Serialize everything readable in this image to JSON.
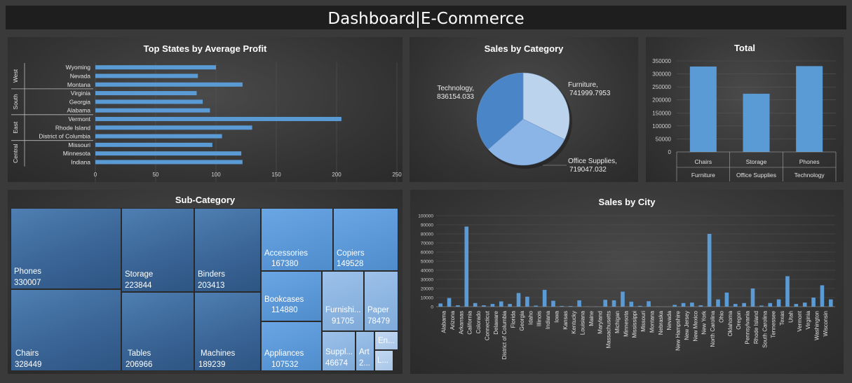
{
  "dashboard": {
    "title": "Dashboard|E-Commerce"
  },
  "panels": {
    "states": {
      "title": "Top States by Average Profit"
    },
    "category": {
      "title": "Sales by Category"
    },
    "total": {
      "title": "Total"
    },
    "subcategory": {
      "title": "Sub-Category"
    },
    "city": {
      "title": "Sales by City"
    }
  },
  "chart_data": [
    {
      "type": "bar",
      "orientation": "horizontal",
      "title": "Top States by Average Profit",
      "groups": [
        {
          "name": "West",
          "categories": [
            "Wyoming",
            "Nevada",
            "Montana"
          ],
          "values": [
            100,
            85,
            122
          ]
        },
        {
          "name": "South",
          "categories": [
            "Virginia",
            "Georgia",
            "Alabama"
          ],
          "values": [
            84,
            89,
            95
          ]
        },
        {
          "name": "East",
          "categories": [
            "Vermont",
            "Rhode Island",
            "District of Columbia"
          ],
          "values": [
            204,
            130,
            105
          ]
        },
        {
          "name": "Central",
          "categories": [
            "Missouri",
            "Minnesota",
            "Indiana"
          ],
          "values": [
            97,
            121,
            122
          ]
        }
      ],
      "xticks": [
        "0",
        "50",
        "100",
        "150",
        "200",
        "250"
      ],
      "xlim": [
        0,
        250
      ],
      "color": "#5b9bd5"
    },
    {
      "type": "pie",
      "title": "Sales by Category",
      "slices": [
        {
          "label": "Furniture",
          "value": 741999.7953,
          "text": "Furniture,",
          "valtext": "741999.7953",
          "color": "#bcd3ee"
        },
        {
          "label": "Office Supplies",
          "value": 719047.032,
          "text": "Office Supplies,",
          "valtext": "719047.032",
          "color": "#8bb5e6"
        },
        {
          "label": "Technology",
          "value": 836154.033,
          "text": "Technology,",
          "valtext": "836154.033",
          "color": "#4a85c8"
        }
      ]
    },
    {
      "type": "bar",
      "title": "Total",
      "categories": [
        {
          "item": "Chairs",
          "group": "Furniture",
          "value": 328449
        },
        {
          "item": "Storage",
          "group": "Office Supplies",
          "value": 223844
        },
        {
          "item": "Phones",
          "group": "Technology",
          "value": 330007
        }
      ],
      "yticks": [
        "0",
        "50000",
        "100000",
        "150000",
        "200000",
        "250000",
        "300000",
        "350000"
      ],
      "ylim": [
        0,
        350000
      ],
      "color": "#5b9bd5"
    },
    {
      "type": "treemap",
      "title": "Sub-Category",
      "cells": [
        {
          "name": "Phones",
          "value": "330007"
        },
        {
          "name": "Chairs",
          "value": "328449"
        },
        {
          "name": "Storage",
          "value": "223844"
        },
        {
          "name": "Tables",
          "value": "206966"
        },
        {
          "name": "Binders",
          "value": "203413"
        },
        {
          "name": "Machines",
          "value": "189239"
        },
        {
          "name": "Accessories",
          "value": "167380"
        },
        {
          "name": "Copiers",
          "value": "149528"
        },
        {
          "name": "Bookcases",
          "value": "114880"
        },
        {
          "name": "Appliances",
          "value": "107532"
        },
        {
          "name": "Furnishi...",
          "value": "91705"
        },
        {
          "name": "Paper",
          "value": "78479"
        },
        {
          "name": "Suppl...",
          "value": "46674"
        },
        {
          "name": "Art",
          "value": "2..."
        },
        {
          "name": "En...",
          "value": ""
        },
        {
          "name": "L...",
          "value": ""
        }
      ]
    },
    {
      "type": "bar",
      "title": "Sales by City",
      "categories": [
        "Alabama",
        "Arizona",
        "Arkansas",
        "California",
        "Colorado",
        "Connecticut",
        "Delaware",
        "District of Columbia",
        "Florida",
        "Georgia",
        "Idaho",
        "Illinois",
        "Indiana",
        "Iowa",
        "Kansas",
        "Kentucky",
        "Louisiana",
        "Maine",
        "Maryland",
        "Massachusetts",
        "Michigan",
        "Minnesota",
        "Mississippi",
        "Missouri",
        "Montana",
        "Nebraska",
        "Nevada",
        "New Hampshire",
        "New Jersey",
        "New Mexico",
        "New York",
        "North Carolina",
        "Ohio",
        "Oklahoma",
        "Oregon",
        "Pennsylvania",
        "Rhode Island",
        "South Carolina",
        "Tennessee",
        "Texas",
        "Utah",
        "Vermont",
        "Virginia",
        "Washington",
        "Wisconsin"
      ],
      "values": [
        3500,
        9500,
        1500,
        88000,
        4000,
        1500,
        3000,
        5800,
        3000,
        15000,
        11000,
        1200,
        18500,
        6500,
        800,
        700,
        7000,
        200,
        200,
        7500,
        7000,
        16500,
        5500,
        900,
        6000,
        200,
        100,
        2000,
        4000,
        4500,
        1500,
        80000,
        8000,
        15500,
        3000,
        4000,
        20000,
        1200,
        4000,
        8000,
        33500,
        3000,
        4500,
        10000,
        23500,
        8000
      ],
      "yticks": [
        "0",
        "10000",
        "20000",
        "30000",
        "40000",
        "50000",
        "60000",
        "70000",
        "80000",
        "90000",
        "100000"
      ],
      "ylim": [
        0,
        100000
      ],
      "color": "#5b9bd5"
    }
  ]
}
